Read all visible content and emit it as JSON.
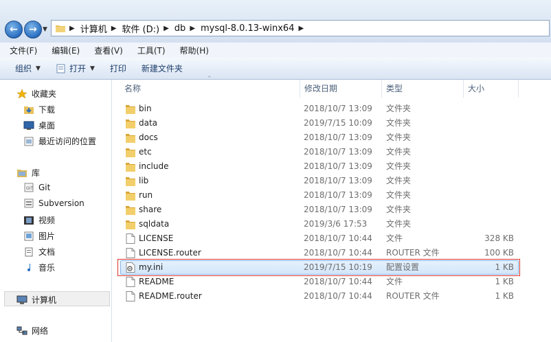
{
  "address": {
    "crumbs": [
      "计算机",
      "软件 (D:)",
      "db",
      "mysql-8.0.13-winx64"
    ]
  },
  "menu": [
    "文件(F)",
    "编辑(E)",
    "查看(V)",
    "工具(T)",
    "帮助(H)"
  ],
  "toolbar": {
    "organize": "组织",
    "open": "打开",
    "print": "打印",
    "new_folder": "新建文件夹"
  },
  "nav": {
    "favorites": "收藏夹",
    "downloads": "下载",
    "desktop": "桌面",
    "recent": "最近访问的位置",
    "libraries": "库",
    "git": "Git",
    "subversion": "Subversion",
    "videos": "视频",
    "pictures": "图片",
    "documents": "文档",
    "music": "音乐",
    "computer": "计算机",
    "network": "网络"
  },
  "columns": {
    "name": "名称",
    "date": "修改日期",
    "type": "类型",
    "size": "大小"
  },
  "files": [
    {
      "name": "bin",
      "date": "2018/10/7 13:09",
      "type": "文件夹",
      "size": "",
      "kind": "folder"
    },
    {
      "name": "data",
      "date": "2019/7/15 10:09",
      "type": "文件夹",
      "size": "",
      "kind": "folder"
    },
    {
      "name": "docs",
      "date": "2018/10/7 13:09",
      "type": "文件夹",
      "size": "",
      "kind": "folder"
    },
    {
      "name": "etc",
      "date": "2018/10/7 13:09",
      "type": "文件夹",
      "size": "",
      "kind": "folder"
    },
    {
      "name": "include",
      "date": "2018/10/7 13:09",
      "type": "文件夹",
      "size": "",
      "kind": "folder"
    },
    {
      "name": "lib",
      "date": "2018/10/7 13:09",
      "type": "文件夹",
      "size": "",
      "kind": "folder"
    },
    {
      "name": "run",
      "date": "2018/10/7 13:09",
      "type": "文件夹",
      "size": "",
      "kind": "folder"
    },
    {
      "name": "share",
      "date": "2018/10/7 13:09",
      "type": "文件夹",
      "size": "",
      "kind": "folder"
    },
    {
      "name": "sqldata",
      "date": "2019/3/6 17:53",
      "type": "文件夹",
      "size": "",
      "kind": "folder"
    },
    {
      "name": "LICENSE",
      "date": "2018/10/7 10:44",
      "type": "文件",
      "size": "328 KB",
      "kind": "file"
    },
    {
      "name": "LICENSE.router",
      "date": "2018/10/7 10:44",
      "type": "ROUTER 文件",
      "size": "100 KB",
      "kind": "file"
    },
    {
      "name": "my.ini",
      "date": "2019/7/15 10:19",
      "type": "配置设置",
      "size": "1 KB",
      "kind": "ini",
      "selected": true
    },
    {
      "name": "README",
      "date": "2018/10/7 10:44",
      "type": "文件",
      "size": "1 KB",
      "kind": "file"
    },
    {
      "name": "README.router",
      "date": "2018/10/7 10:44",
      "type": "ROUTER 文件",
      "size": "1 KB",
      "kind": "file"
    }
  ]
}
